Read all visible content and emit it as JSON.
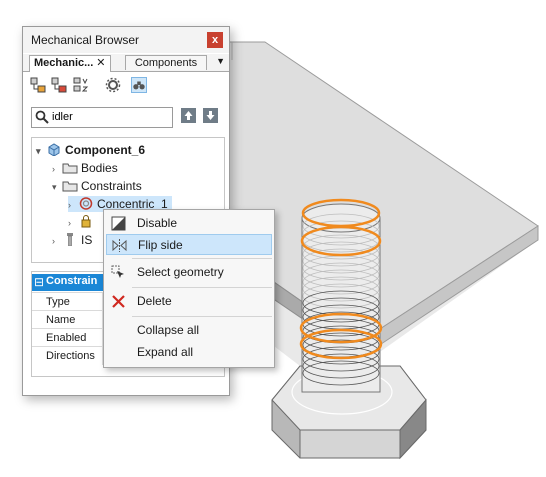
{
  "browser": {
    "title": "Mechanical Browser",
    "close_label": "x",
    "tabs": [
      {
        "label": "Mechanic...",
        "close": "✕"
      },
      {
        "label": "Components"
      }
    ],
    "tab_menu_glyph": "▼",
    "search": {
      "value": "idler"
    },
    "tree": {
      "root": "Component_6",
      "bodies": "Bodies",
      "constraints": "Constraints",
      "concentric": "Concentric_1",
      "iso_partial": "IS"
    },
    "properties": {
      "header": "Constrain",
      "collapse_glyph": "⊟",
      "rows": [
        "Type",
        "Name",
        "Enabled",
        "Directions"
      ]
    }
  },
  "context_menu": {
    "items": [
      {
        "label": "Disable",
        "icon": "disable-icon"
      },
      {
        "label": "Flip side",
        "icon": "flip-side-icon",
        "highlighted": true
      },
      {
        "label": "Select geometry",
        "icon": "select-geometry-icon"
      },
      {
        "label": "Delete",
        "icon": "delete-icon"
      },
      {
        "label": "Collapse all"
      },
      {
        "label": "Expand all"
      }
    ]
  },
  "colors": {
    "accent": "#1b87d6",
    "highlight": "#cde6fb",
    "constraint_ring": "#f08a1e",
    "close_button": "#c8402f",
    "delete_icon": "#d0281f"
  }
}
